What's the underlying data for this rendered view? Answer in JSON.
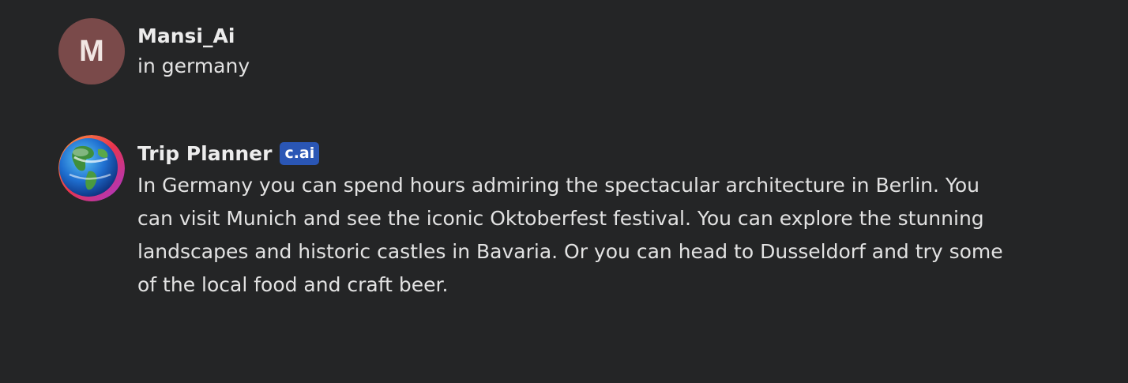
{
  "messages": [
    {
      "author": "Mansi_Ai",
      "avatar_letter": "M",
      "text": "in germany"
    },
    {
      "author": "Trip Planner",
      "badge": "c.ai",
      "avatar_icon": "globe-avatar-icon",
      "text": "In Germany you can spend hours admiring the spectacular architecture in Berlin. You can visit Munich and see the iconic Oktoberfest festival. You can explore the stunning landscapes and historic castles in Bavaria. Or you can head to Dusseldorf and try some of the local food and craft beer."
    }
  ],
  "colors": {
    "background": "#242526",
    "user_avatar": "#7a4a4a",
    "badge": "#2a56b5"
  }
}
